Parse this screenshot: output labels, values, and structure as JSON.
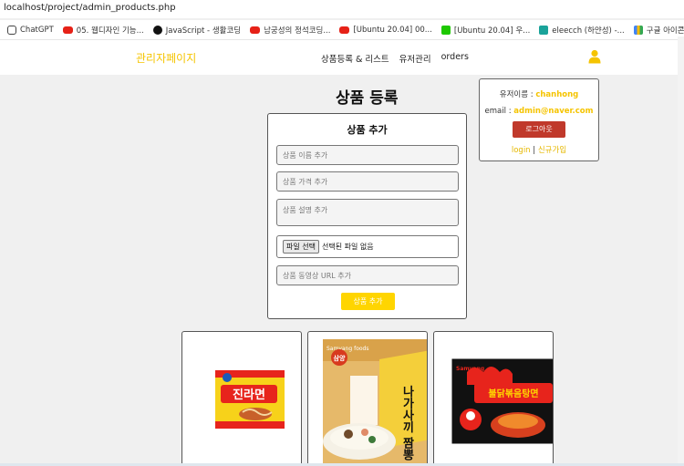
{
  "browser": {
    "url": "localhost/project/admin_products.php",
    "bookmarks": [
      {
        "label": "ChatGPT",
        "icon": "chatgpt-icon"
      },
      {
        "label": "05. 웹디자인 기능...",
        "icon": "youtube-icon"
      },
      {
        "label": "JavaScript - 생활코딩",
        "icon": "circle-icon"
      },
      {
        "label": "남궁성의 정석코딩...",
        "icon": "youtube-icon"
      },
      {
        "label": "[Ubuntu 20.04] 00...",
        "icon": "youtube-icon"
      },
      {
        "label": "[Ubuntu 20.04] 우...",
        "icon": "naver-icon"
      },
      {
        "label": "eleecch (하얀성) -...",
        "icon": "velog-icon"
      },
      {
        "label": "구글 아이콘",
        "icon": "google-icon"
      }
    ]
  },
  "nav": {
    "brand": "관리자페이지",
    "links": [
      "상품등록 & 리스트",
      "유저관리",
      "orders"
    ]
  },
  "page": {
    "title": "상품 등록"
  },
  "user": {
    "name_label": "유저이름 :",
    "name": "chanhong",
    "email_label": "email :",
    "email": "admin@naver.com",
    "logout": "로그아웃",
    "login": "login",
    "separator": "|",
    "signup": "신규가입"
  },
  "form": {
    "title": "상품 추가",
    "name_placeholder": "상품 이름 추가",
    "price_placeholder": "상품 가격 추가",
    "desc_placeholder": "상품 설명 추가",
    "file_button": "파일 선택",
    "file_status": "선택된 파일 없음",
    "video_placeholder": "상품 동영상 URL 추가",
    "submit": "상품 추가"
  },
  "products": [
    {
      "name": "진라면",
      "image": "jin-ramen-image"
    },
    {
      "name": "나가사끼 짬뽕",
      "image": "nagasaki-ramen-image",
      "brand": "삼양",
      "sub": "Samyang foods"
    },
    {
      "name": "불닭볶음탕면",
      "image": "buldak-ramen-image",
      "brand": "Samyang"
    }
  ],
  "colors": {
    "accent": "#f5c400",
    "logout": "#c0392b",
    "submit": "#ffd500"
  }
}
